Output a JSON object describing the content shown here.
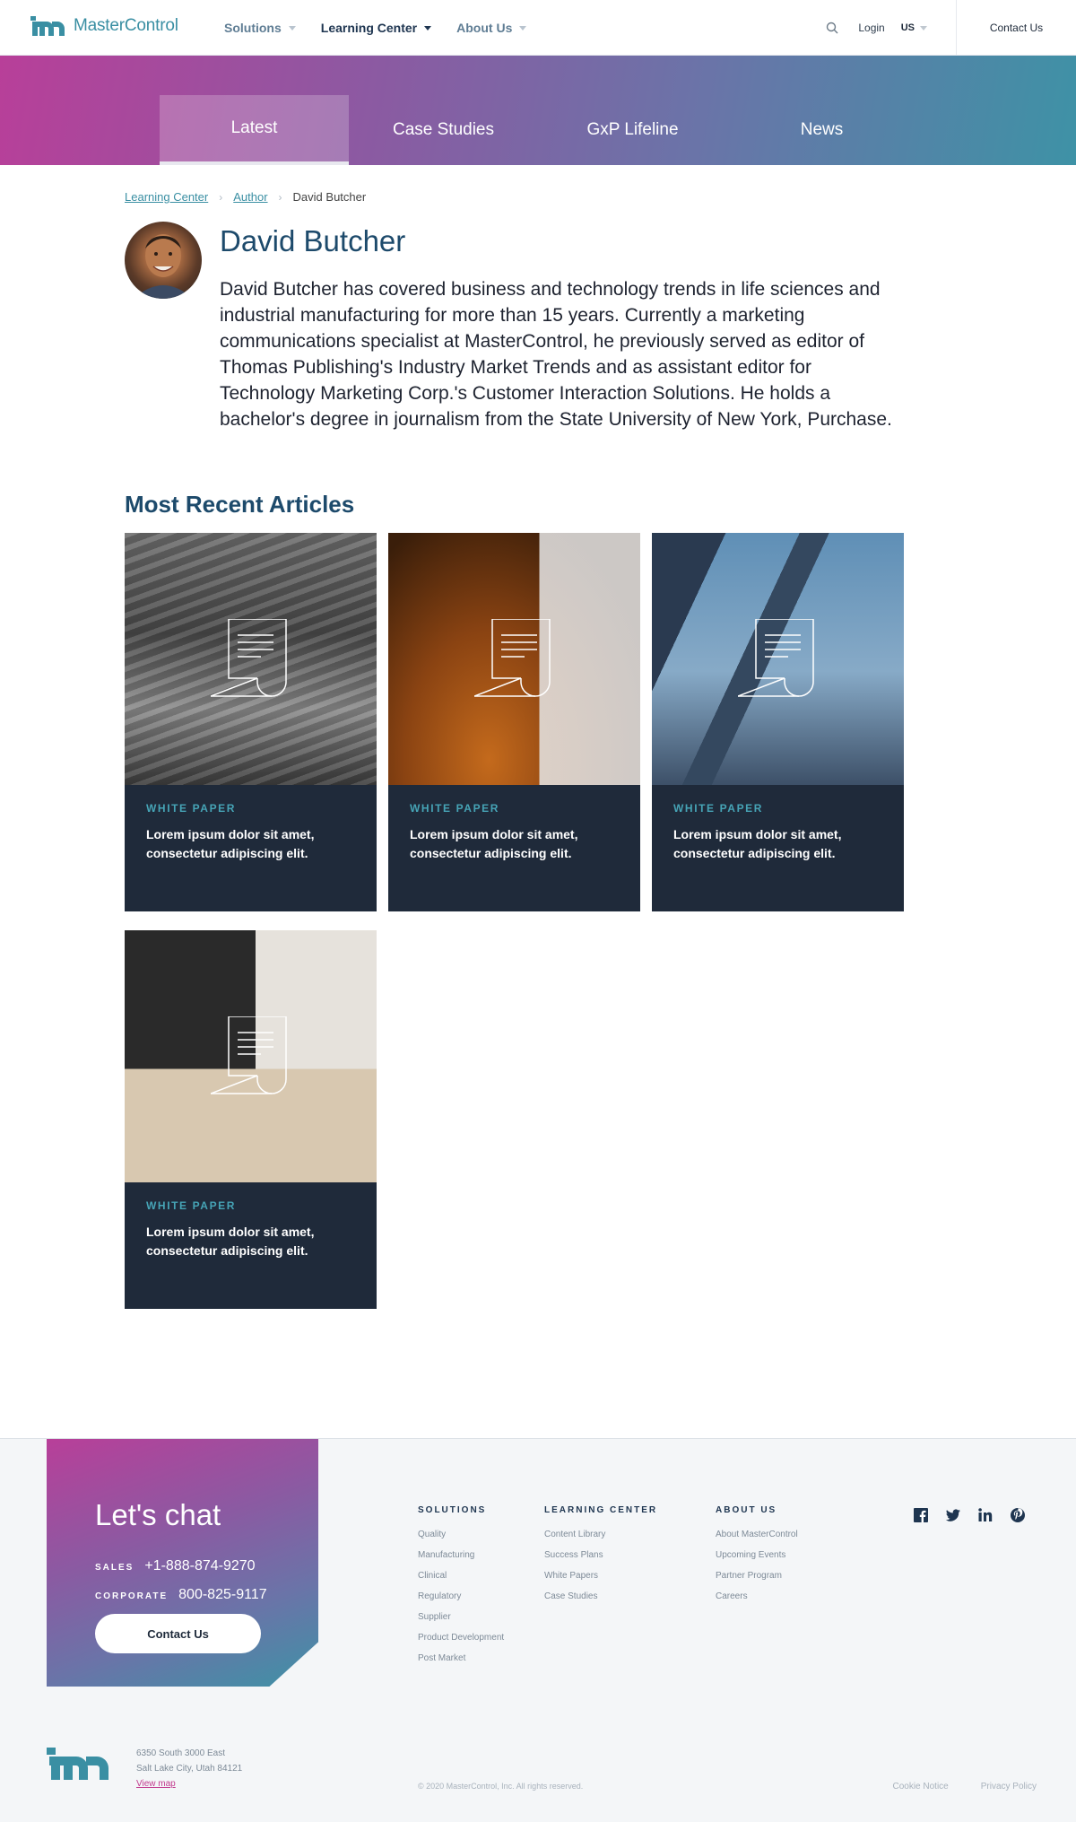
{
  "brand": {
    "name": "MasterControl"
  },
  "topnav": {
    "items": [
      {
        "label": "Solutions"
      },
      {
        "label": "Learning Center"
      },
      {
        "label": "About Us"
      }
    ],
    "login": "Login",
    "locale": "US",
    "contact": "Contact Us"
  },
  "tabs": [
    {
      "label": "Latest"
    },
    {
      "label": "Case Studies"
    },
    {
      "label": "GxP Lifeline"
    },
    {
      "label": "News"
    }
  ],
  "breadcrumb": {
    "items": [
      "Learning Center",
      "Author"
    ],
    "current": "David Butcher"
  },
  "author": {
    "name": "David Butcher",
    "bio": "David Butcher has covered business and technology trends in life sciences and industrial manufacturing for more than 15 years. Currently a marketing communications specialist at MasterControl, he previously served as editor of Thomas Publishing's Industry Market Trends and as assistant editor for Technology Marketing Corp.'s Customer Interaction Solutions. He holds a bachelor's degree in journalism from the State University of New York, Purchase."
  },
  "articles": {
    "title": "Most Recent Articles",
    "items": [
      {
        "tag": "WHITE PAPER",
        "title": "Lorem ipsum dolor sit amet, consectetur adipiscing elit."
      },
      {
        "tag": "WHITE PAPER",
        "title": "Lorem ipsum dolor sit amet, consectetur adipiscing elit."
      },
      {
        "tag": "WHITE PAPER",
        "title": "Lorem ipsum dolor sit amet, consectetur adipiscing elit."
      },
      {
        "tag": "WHITE PAPER",
        "title": "Lorem ipsum dolor sit amet, consectetur adipiscing elit."
      }
    ]
  },
  "footer": {
    "chat": {
      "title": "Let's chat",
      "sales_label": "SALES",
      "sales_phone": "+1-888-874-9270",
      "corporate_label": "CORPORATE",
      "corporate_phone": "800-825-9117",
      "button": "Contact Us"
    },
    "columns": [
      {
        "heading": "SOLUTIONS",
        "links": [
          "Quality",
          "Manufacturing",
          "Clinical",
          "Regulatory",
          "Supplier",
          "Product Development",
          "Post Market"
        ]
      },
      {
        "heading": "LEARNING CENTER",
        "links": [
          "Content Library",
          "Success Plans",
          "White Papers",
          "Case Studies"
        ]
      },
      {
        "heading": "ABOUT US",
        "links": [
          "About MasterControl",
          "Upcoming Events",
          "Partner Program",
          "Careers"
        ]
      }
    ],
    "social": [
      "facebook-icon",
      "twitter-icon",
      "linkedin-icon",
      "pinterest-icon"
    ],
    "address_line1": "6350 South 3000 East",
    "address_line2": "Salt Lake City, Utah 84121",
    "map_link": "View map",
    "copyright": "© 2020 MasterControl, Inc. All rights reserved.",
    "cookie": "Cookie Notice",
    "privacy": "Privacy Policy"
  },
  "colors": {
    "accent": "#3a8fa3",
    "heading": "#1d4a6b",
    "card_bg": "#1f2a3a",
    "magenta": "#b83f99"
  }
}
